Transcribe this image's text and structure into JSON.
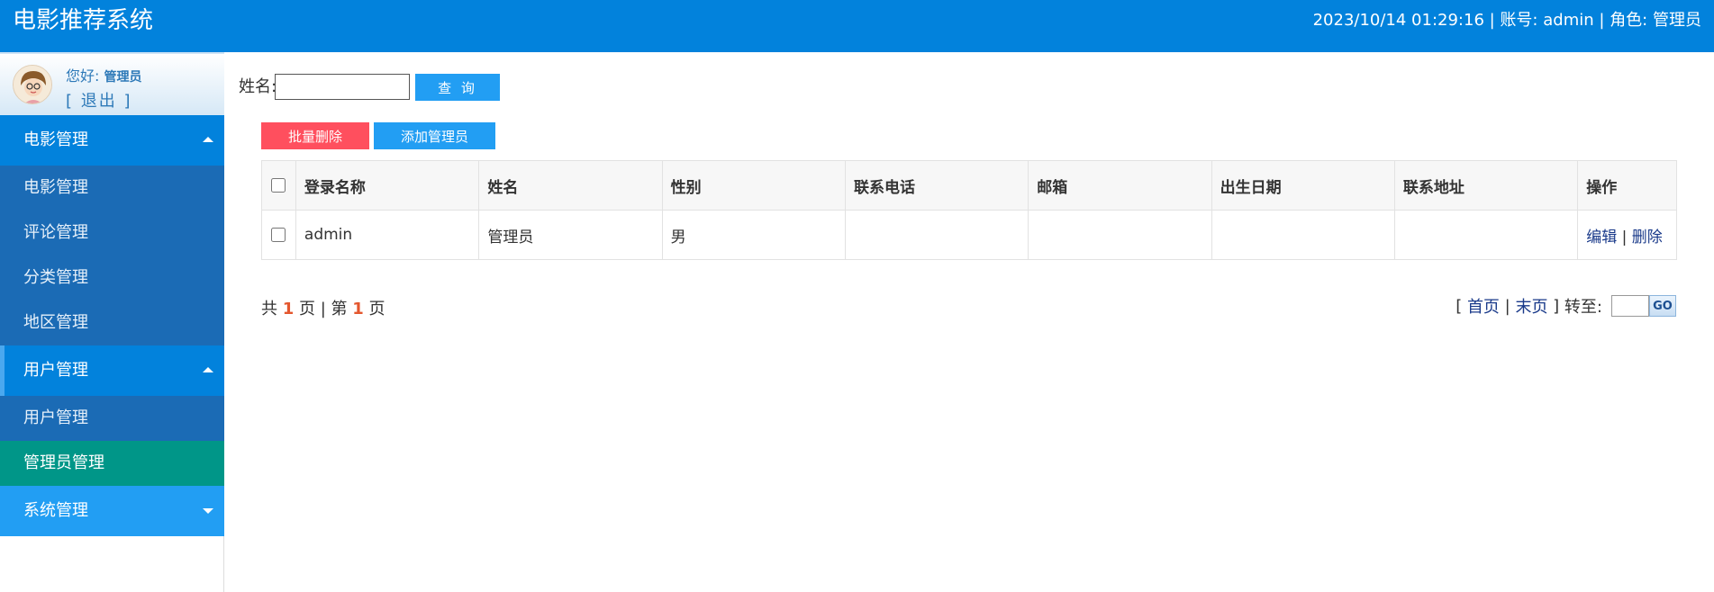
{
  "header": {
    "title": "电影推荐系统",
    "datetime": "2023/10/14 01:29:16",
    "account_label": "账号:",
    "account": "admin",
    "role_label": "角色:",
    "role": "管理员"
  },
  "profile": {
    "greeting": "您好:",
    "role": "管理员",
    "logout": "[ 退出 ]"
  },
  "nav": {
    "group_movies": "电影管理",
    "items_movies": [
      "电影管理",
      "评论管理",
      "分类管理",
      "地区管理"
    ],
    "group_users": "用户管理",
    "items_users": [
      "用户管理",
      "管理员管理"
    ],
    "group_system": "系统管理"
  },
  "search": {
    "label": "姓名:",
    "value": "",
    "button": "查 询"
  },
  "actions": {
    "batch_delete": "批量删除",
    "add_admin": "添加管理员"
  },
  "table": {
    "headers": [
      "登录名称",
      "姓名",
      "性别",
      "联系电话",
      "邮箱",
      "出生日期",
      "联系地址",
      "操作"
    ],
    "rows": [
      {
        "login": "admin",
        "name": "管理员",
        "gender": "男",
        "phone": "",
        "email": "",
        "birth": "",
        "address": "",
        "edit": "编辑",
        "sep": "|",
        "delete": "删除"
      }
    ]
  },
  "pager": {
    "total_prefix": "共",
    "total_pages": "1",
    "total_suffix": "页 | 第",
    "current_page": "1",
    "current_suffix": "页",
    "first": "首页",
    "last": "末页",
    "goto_label": "转至:",
    "go": "GO"
  },
  "colors": {
    "header_bg": "#0282dc",
    "nav_active": "#009688",
    "nav_item_bg": "#1b6bb5",
    "btn_primary": "#229ef3",
    "btn_danger": "#ff4f5e"
  }
}
